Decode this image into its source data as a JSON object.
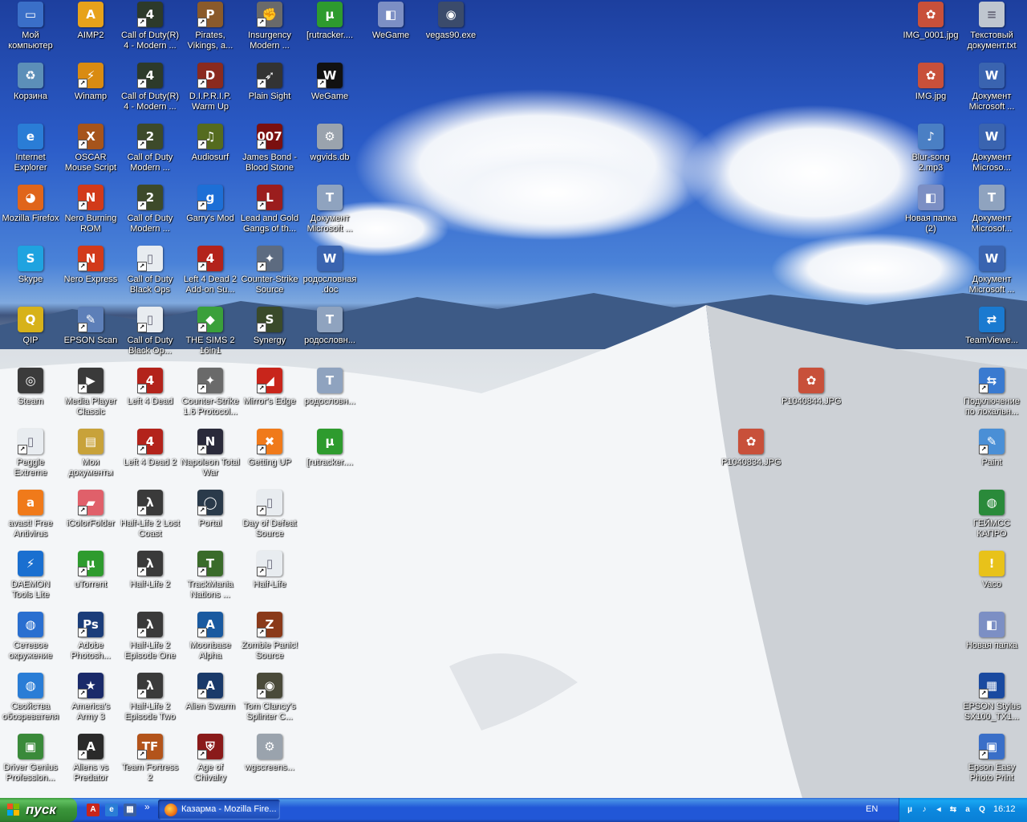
{
  "icons": [
    {
      "label": "Мой компьютер",
      "glyph": "▭",
      "icon": "my-computer-icon",
      "color": "#3a6fc8",
      "shortcut": false
    },
    {
      "label": "AIMP2",
      "glyph": "A",
      "icon": "aimp-icon",
      "color": "#e7a21b",
      "shortcut": false
    },
    {
      "label": "Call of Duty(R) 4 - Modern ...",
      "glyph": "4",
      "icon": "cod4-icon",
      "color": "#2d3a2a",
      "shortcut": true
    },
    {
      "label": "Pirates, Vikings, a...",
      "glyph": "P",
      "icon": "pirates-vikings-icon",
      "color": "#8a5a2b",
      "shortcut": true
    },
    {
      "label": "Insurgency Modern ...",
      "glyph": "✊",
      "icon": "insurgency-icon",
      "color": "#6a6a6a",
      "shortcut": true
    },
    {
      "label": "[rutracker....",
      "glyph": "µ",
      "icon": "utorrent-file-icon",
      "color": "#2e9b2e",
      "shortcut": false
    },
    {
      "label": "WeGame",
      "glyph": "◧",
      "icon": "wegame-folder-icon",
      "color": "#7c8fc4",
      "shortcut": false
    },
    {
      "label": "vegas90.exe",
      "glyph": "◉",
      "icon": "vegas-icon",
      "color": "#3b4b6b",
      "shortcut": false
    },
    {
      "label": "IMG_0001.jpg",
      "glyph": "✿",
      "icon": "image-file-icon",
      "color": "#c8503a",
      "shortcut": false
    },
    {
      "label": "Текстовый документ.txt",
      "glyph": "≡",
      "icon": "text-file-icon",
      "color": "#bfc6cf",
      "shortcut": false
    },
    {
      "label": "Корзина",
      "glyph": "♻",
      "icon": "recycle-bin-icon",
      "color": "#5c8fb8",
      "shortcut": false
    },
    {
      "label": "Winamp",
      "glyph": "⚡",
      "icon": "winamp-icon",
      "color": "#d98b12",
      "shortcut": true
    },
    {
      "label": "Call of Duty(R) 4 - Modern ...",
      "glyph": "4",
      "icon": "cod4-mp-icon",
      "color": "#2d3a2a",
      "shortcut": true
    },
    {
      "label": "D.I.P.R.I.P. Warm Up",
      "glyph": "D",
      "icon": "diprip-icon",
      "color": "#8a2a1e",
      "shortcut": true
    },
    {
      "label": "Plain Sight",
      "glyph": "➶",
      "icon": "plain-sight-icon",
      "color": "#333333",
      "shortcut": true
    },
    {
      "label": "WeGame",
      "glyph": "W",
      "icon": "wegame-icon",
      "color": "#111111",
      "shortcut": true
    },
    {
      "label": "IMG.jpg",
      "glyph": "✿",
      "icon": "image-file-icon",
      "color": "#c8503a",
      "shortcut": false
    },
    {
      "label": "Документ Microsoft ...",
      "glyph": "W",
      "icon": "word-doc-icon",
      "color": "#3a64b0",
      "shortcut": false
    },
    {
      "label": "Internet Explorer",
      "glyph": "e",
      "icon": "internet-explorer-icon",
      "color": "#2a7dd6",
      "shortcut": false
    },
    {
      "label": "OSCAR Mouse Script Editor",
      "glyph": "X",
      "icon": "oscar-icon",
      "color": "#a6541b",
      "shortcut": true
    },
    {
      "label": "Call of Duty Modern ...",
      "glyph": "2",
      "icon": "cod-mw2-icon",
      "color": "#3d4a2a",
      "shortcut": true
    },
    {
      "label": "Audiosurf",
      "glyph": "♫",
      "icon": "audiosurf-icon",
      "color": "#556b1f",
      "shortcut": true
    },
    {
      "label": "James Bond - Blood Stone",
      "glyph": "007",
      "icon": "james-bond-icon",
      "color": "#7a1010",
      "shortcut": true
    },
    {
      "label": "wgvids.db",
      "glyph": "⚙",
      "icon": "db-file-icon",
      "color": "#9aa3ad",
      "shortcut": false
    },
    {
      "label": "Blur-song 2.mp3",
      "glyph": "♪",
      "icon": "mp3-file-icon",
      "color": "#4a7fc4",
      "shortcut": false
    },
    {
      "label": "Документ Microso...",
      "glyph": "W",
      "icon": "word-doc-icon",
      "color": "#3a64b0",
      "shortcut": false
    },
    {
      "label": "Mozilla Firefox",
      "glyph": "◕",
      "icon": "firefox-icon",
      "color": "#e0651b",
      "shortcut": false
    },
    {
      "label": "Nero Burning ROM",
      "glyph": "N",
      "icon": "nero-burning-icon",
      "color": "#d23a1a",
      "shortcut": true
    },
    {
      "label": "Call of Duty Modern ...",
      "glyph": "2",
      "icon": "cod-mw2-mp-icon",
      "color": "#3d4a2a",
      "shortcut": true
    },
    {
      "label": "Garry's Mod",
      "glyph": "g",
      "icon": "garrys-mod-icon",
      "color": "#1d6fd6",
      "shortcut": true
    },
    {
      "label": "Lead and Gold Gangs of th...",
      "glyph": "L",
      "icon": "lead-and-gold-icon",
      "color": "#9b1d1d",
      "shortcut": true
    },
    {
      "label": "Документ Microsoft ...",
      "glyph": "T",
      "icon": "tiff-doc-icon",
      "color": "#8fa3bf",
      "shortcut": false
    },
    {
      "label": "Новая папка (2)",
      "glyph": "◧",
      "icon": "folder-icon",
      "color": "#7c8fc4",
      "shortcut": false
    },
    {
      "label": "Документ Microsof...",
      "glyph": "T",
      "icon": "tiff-doc-icon",
      "color": "#8fa3bf",
      "shortcut": false
    },
    {
      "label": "Skype",
      "glyph": "S",
      "icon": "skype-icon",
      "color": "#1fa3e0",
      "shortcut": false
    },
    {
      "label": "Nero Express",
      "glyph": "N",
      "icon": "nero-express-icon",
      "color": "#d23a1a",
      "shortcut": true
    },
    {
      "label": "Call of Duty Black Ops",
      "glyph": "▯",
      "icon": "blank-shortcut-icon",
      "color": "#e8ecf0",
      "shortcut": true
    },
    {
      "label": "Left 4 Dead 2 Add-on Su...",
      "glyph": "4",
      "icon": "l4d2-addon-icon",
      "color": "#b3231b",
      "shortcut": true
    },
    {
      "label": "Counter-Strike Source",
      "glyph": "✦",
      "icon": "cs-source-icon",
      "color": "#5d6b80",
      "shortcut": true
    },
    {
      "label": "родословная .doc",
      "glyph": "W",
      "icon": "word-doc-icon",
      "color": "#3a64b0",
      "shortcut": false
    },
    {
      "label": "Документ Microsoft ...",
      "glyph": "W",
      "icon": "word-doc-icon",
      "color": "#3a64b0",
      "shortcut": false
    },
    {
      "label": "QIP",
      "glyph": "Q",
      "icon": "qip-icon",
      "color": "#d7b21a",
      "shortcut": false
    },
    {
      "label": "EPSON Scan",
      "glyph": "✎",
      "icon": "epson-scan-icon",
      "color": "#5d7fb8",
      "shortcut": true
    },
    {
      "label": "Call of Duty Black Op...",
      "glyph": "▯",
      "icon": "blank-shortcut-icon",
      "color": "#e8ecf0",
      "shortcut": true
    },
    {
      "label": "THE SIMS 2 16in1",
      "glyph": "◆",
      "icon": "sims2-icon",
      "color": "#3aa03a",
      "shortcut": true
    },
    {
      "label": "Synergy",
      "glyph": "S",
      "icon": "synergy-icon",
      "color": "#3a4a2a",
      "shortcut": true
    },
    {
      "label": "родословн...",
      "glyph": "T",
      "icon": "tiff-doc-icon",
      "color": "#8fa3bf",
      "shortcut": false
    },
    {
      "label": "TeamViewe...",
      "glyph": "⇄",
      "icon": "teamviewer-icon",
      "color": "#1a7ad0",
      "shortcut": false
    },
    {
      "label": "Steam",
      "glyph": "◎",
      "icon": "steam-icon",
      "color": "#3b3b3b",
      "shortcut": false
    },
    {
      "label": "Media Player Classic",
      "glyph": "▶",
      "icon": "media-player-classic-icon",
      "color": "#3a3a3a",
      "shortcut": true
    },
    {
      "label": "Left 4 Dead",
      "glyph": "4",
      "icon": "l4d-icon",
      "color": "#b3231b",
      "shortcut": true
    },
    {
      "label": "Counter-Strike 1.6 Protocol...",
      "glyph": "✦",
      "icon": "cs16-icon",
      "color": "#6a6a6a",
      "shortcut": true
    },
    {
      "label": "Mirror's Edge",
      "glyph": "◢",
      "icon": "mirrors-edge-icon",
      "color": "#c8251b",
      "shortcut": true
    },
    {
      "label": "родословн...",
      "glyph": "T",
      "icon": "tiff-doc-icon",
      "color": "#8fa3bf",
      "shortcut": false
    },
    {
      "label": "P1040844.JPG",
      "glyph": "✿",
      "icon": "image-file-icon",
      "color": "#c8503a",
      "shortcut": false
    },
    {
      "label": "Подключение по локальн...",
      "glyph": "⇆",
      "icon": "network-connection-icon",
      "color": "#3a7ad0",
      "shortcut": true
    },
    {
      "label": "Peggle Extreme",
      "glyph": "▯",
      "icon": "blank-shortcut-icon",
      "color": "#e8ecf0",
      "shortcut": true
    },
    {
      "label": "Мои документы",
      "glyph": "▤",
      "icon": "my-documents-icon",
      "color": "#c8a23a",
      "shortcut": false
    },
    {
      "label": "Left 4 Dead 2",
      "glyph": "4",
      "icon": "l4d2-icon",
      "color": "#b3231b",
      "shortcut": true
    },
    {
      "label": "Napoleon Total War",
      "glyph": "N",
      "icon": "napoleon-icon",
      "color": "#2a2a3a",
      "shortcut": true
    },
    {
      "label": "Getting UP",
      "glyph": "✖",
      "icon": "getting-up-icon",
      "color": "#f07a1a",
      "shortcut": true
    },
    {
      "label": "[rutracker....",
      "glyph": "µ",
      "icon": "utorrent-file-icon",
      "color": "#2e9b2e",
      "shortcut": false
    },
    {
      "label": "P1040834.JPG",
      "glyph": "✿",
      "icon": "image-file-icon",
      "color": "#c8503a",
      "shortcut": false
    },
    {
      "label": "Paint",
      "glyph": "✎",
      "icon": "paint-icon",
      "color": "#4a8fd6",
      "shortcut": true
    },
    {
      "label": "avast! Free Antivirus",
      "glyph": "a",
      "icon": "avast-icon",
      "color": "#f07a1a",
      "shortcut": false
    },
    {
      "label": "iColorFolder",
      "glyph": "▰",
      "icon": "icolorfolder-icon",
      "color": "#e0606a",
      "shortcut": true
    },
    {
      "label": "Half-Life 2 Lost Coast",
      "glyph": "λ",
      "icon": "hl2-lost-coast-icon",
      "color": "#3a3a3a",
      "shortcut": true
    },
    {
      "label": "Portal",
      "glyph": "◯",
      "icon": "portal-icon",
      "color": "#2a3a4a",
      "shortcut": true
    },
    {
      "label": "Day of Defeat Source",
      "glyph": "▯",
      "icon": "blank-shortcut-icon",
      "color": "#e8ecf0",
      "shortcut": true
    },
    {
      "label": "ГЕЙМСС КАПРО",
      "glyph": "◍",
      "icon": "globe-icon",
      "color": "#2a8a3a",
      "shortcut": false
    },
    {
      "label": "DAEMON Tools Lite",
      "glyph": "⚡",
      "icon": "daemon-tools-icon",
      "color": "#1a6fd0",
      "shortcut": false
    },
    {
      "label": "uTorrent",
      "glyph": "µ",
      "icon": "utorrent-icon",
      "color": "#2e9b2e",
      "shortcut": true
    },
    {
      "label": "Half-Life 2",
      "glyph": "λ",
      "icon": "hl2-icon",
      "color": "#3a3a3a",
      "shortcut": true
    },
    {
      "label": "TrackMania Nations ...",
      "glyph": "T",
      "icon": "trackmania-icon",
      "color": "#3a6b2a",
      "shortcut": true
    },
    {
      "label": "Half-Life",
      "glyph": "▯",
      "icon": "blank-shortcut-icon",
      "color": "#e8ecf0",
      "shortcut": true
    },
    {
      "label": "Vaco",
      "glyph": "!",
      "icon": "warning-icon",
      "color": "#e8c21a",
      "shortcut": false
    },
    {
      "label": "Сетевое окружение",
      "glyph": "◍",
      "icon": "network-places-icon",
      "color": "#2a6fd0",
      "shortcut": false
    },
    {
      "label": "Adobe Photosh...",
      "glyph": "Ps",
      "icon": "photoshop-icon",
      "color": "#1b3d7a",
      "shortcut": true
    },
    {
      "label": "Half-Life 2 Episode One",
      "glyph": "λ",
      "icon": "hl2-ep1-icon",
      "color": "#3a3a3a",
      "shortcut": true
    },
    {
      "label": "Moonbase Alpha",
      "glyph": "A",
      "icon": "moonbase-alpha-icon",
      "color": "#1a5aa0",
      "shortcut": true
    },
    {
      "label": "Zombie Panic! Source",
      "glyph": "Z",
      "icon": "zombie-panic-icon",
      "color": "#8a3a1a",
      "shortcut": true
    },
    {
      "label": "Новая папка",
      "glyph": "◧",
      "icon": "folder-icon",
      "color": "#7c8fc4",
      "shortcut": false
    },
    {
      "label": "Свойства обозревателя",
      "glyph": "◍",
      "icon": "internet-options-icon",
      "color": "#2a7dd6",
      "shortcut": false
    },
    {
      "label": "America's Army 3",
      "glyph": "★",
      "icon": "americas-army-icon",
      "color": "#1a2a6a",
      "shortcut": true
    },
    {
      "label": "Half-Life 2 Episode Two",
      "glyph": "λ",
      "icon": "hl2-ep2-icon",
      "color": "#3a3a3a",
      "shortcut": true
    },
    {
      "label": "Alien Swarm",
      "glyph": "A",
      "icon": "alien-swarm-icon",
      "color": "#1a3a6a",
      "shortcut": true
    },
    {
      "label": "Tom Clancy's Splinter C...",
      "glyph": "◉",
      "icon": "splinter-cell-icon",
      "color": "#4a4a3a",
      "shortcut": true
    },
    {
      "label": "EPSON Stylus SX100_TX1...",
      "glyph": "▦",
      "icon": "epson-printer-icon",
      "color": "#1a4aa0",
      "shortcut": true
    },
    {
      "label": "Driver Genius Profession...",
      "glyph": "▣",
      "icon": "driver-genius-icon",
      "color": "#3a8a3a",
      "shortcut": false
    },
    {
      "label": "Aliens vs Predator",
      "glyph": "A",
      "icon": "aliens-vs-predator-icon",
      "color": "#2a2a2a",
      "shortcut": true
    },
    {
      "label": "Team Fortress 2",
      "glyph": "TF",
      "icon": "tf2-icon",
      "color": "#b3541b",
      "shortcut": true
    },
    {
      "label": "Age of Chivalry",
      "glyph": "⛨",
      "icon": "age-of-chivalry-icon",
      "color": "#8a1a1a",
      "shortcut": true
    },
    {
      "label": "wgscreens...",
      "glyph": "⚙",
      "icon": "settings-file-icon",
      "color": "#9aa3ad",
      "shortcut": false
    },
    {
      "label": "Epson Easy Photo Print",
      "glyph": "▣",
      "icon": "epson-photo-icon",
      "color": "#3a6fc8",
      "shortcut": true
    }
  ],
  "taskbar": {
    "start_label": "пуск",
    "quicklaunch": [
      {
        "icon": "pdf-icon",
        "glyph": "A",
        "color": "#c8251b"
      },
      {
        "icon": "internet-explorer-icon",
        "glyph": "e",
        "color": "#2a7dd6"
      },
      {
        "icon": "show-desktop-icon",
        "glyph": "▦",
        "color": "#3a5fa0"
      }
    ],
    "overflow": "»",
    "task_title": "Казарма - Mozilla Fire...",
    "language": "EN",
    "tray_icons": [
      {
        "icon": "utorrent-tray-icon",
        "glyph": "µ"
      },
      {
        "icon": "volume-icon",
        "glyph": "♪"
      },
      {
        "icon": "speaker-icon",
        "glyph": "◂"
      },
      {
        "icon": "network-tray-icon",
        "glyph": "⇆"
      },
      {
        "icon": "avast-tray-icon",
        "glyph": "a"
      },
      {
        "icon": "qip-tray-icon",
        "glyph": "Q"
      }
    ],
    "clock": "16:12"
  }
}
